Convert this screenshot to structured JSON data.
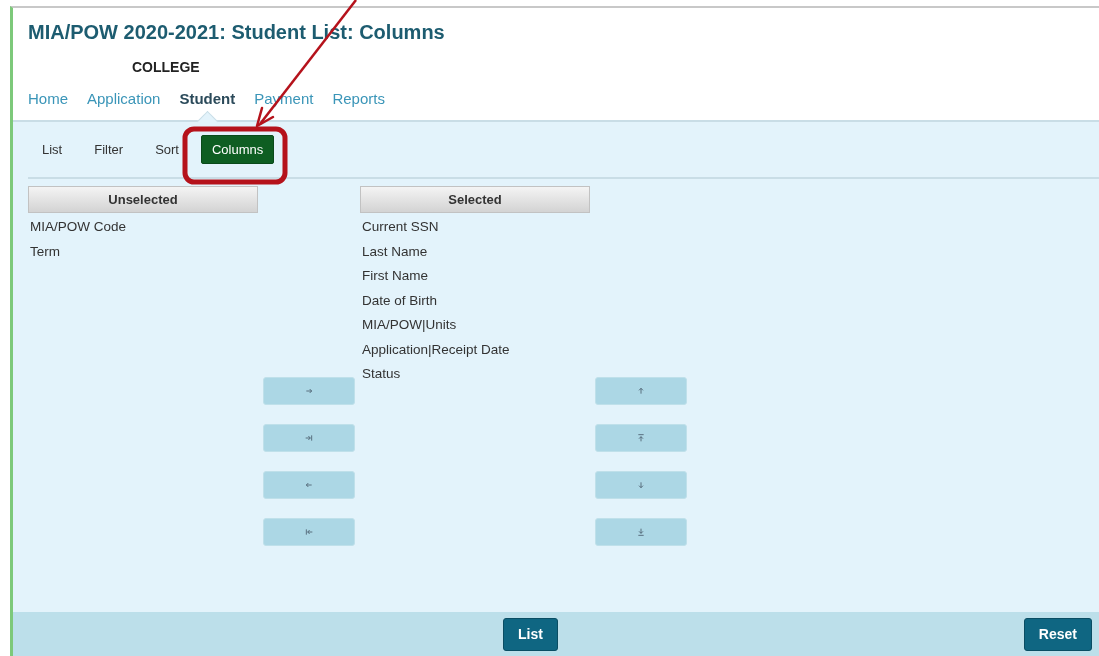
{
  "page": {
    "title": "MIA/POW 2020-2021: Student List: Columns",
    "institution": "COLLEGE"
  },
  "nav": [
    {
      "label": "Home",
      "selected": false
    },
    {
      "label": "Application",
      "selected": false
    },
    {
      "label": "Student",
      "selected": true
    },
    {
      "label": "Payment",
      "selected": false
    },
    {
      "label": "Reports",
      "selected": false
    }
  ],
  "subtabs": [
    {
      "label": "List",
      "selected": false
    },
    {
      "label": "Filter",
      "selected": false
    },
    {
      "label": "Sort",
      "selected": false
    },
    {
      "label": "Columns",
      "selected": true
    }
  ],
  "unselected": {
    "header": "Unselected",
    "items": [
      "MIA/POW Code",
      "Term"
    ]
  },
  "selected": {
    "header": "Selected",
    "items": [
      "Current SSN",
      "Last Name",
      "First Name",
      "Date of Birth",
      "MIA/POW|Units",
      "Application|Receipt Date",
      "Status"
    ]
  },
  "move_buttons": [
    {
      "kind": "right"
    },
    {
      "kind": "right-all"
    },
    {
      "kind": "left"
    },
    {
      "kind": "left-all"
    }
  ],
  "order_buttons": [
    {
      "kind": "up"
    },
    {
      "kind": "top"
    },
    {
      "kind": "down"
    },
    {
      "kind": "bottom"
    }
  ],
  "footer": {
    "buttons": [
      {
        "label": "List",
        "kind": "center"
      },
      {
        "label": "Reset",
        "kind": "right"
      }
    ]
  }
}
